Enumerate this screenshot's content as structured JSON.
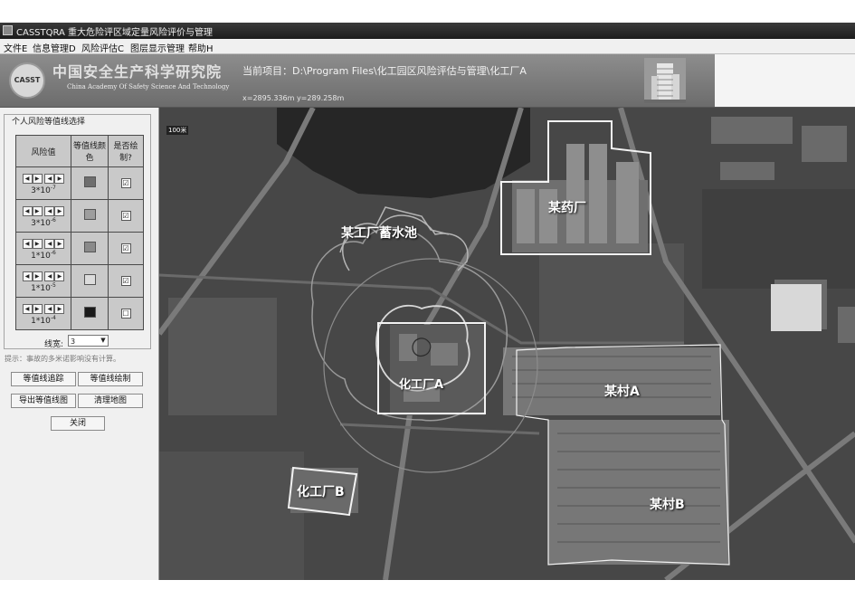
{
  "window": {
    "title": "CASSTQRA 重大危险评区域定量风险评价与管理"
  },
  "menu": [
    "文件E",
    "信息管理D",
    "风险评估C",
    "图层显示管理",
    "帮助H"
  ],
  "header": {
    "logo_text": "CASST",
    "org_cn": "中国安全生产科学研究院",
    "org_en": "China Academy Of Safety Science And Technology",
    "project_label": "当前项目：",
    "project_path": "D:\\Program Files\\化工园区风险评估与管理\\化工厂A",
    "coords": "x=2895.336m   y=289.258m"
  },
  "panel": {
    "group_title": "个人风险等值线选择",
    "col_risk": "风险值",
    "col_color": "等值线颜色",
    "col_draw": "是否绘制?",
    "rows": [
      {
        "base": "3*10",
        "exp": "-7",
        "color": "#6e6e6e",
        "checked": "☑"
      },
      {
        "base": "3*10",
        "exp": "-6",
        "color": "#9e9e9e",
        "checked": "☑"
      },
      {
        "base": "1*10",
        "exp": "-6",
        "color": "#8a8a8a",
        "checked": "☑"
      },
      {
        "base": "1*10",
        "exp": "-5",
        "color": "#dcdcdc",
        "checked": "☑"
      },
      {
        "base": "1*10",
        "exp": "-4",
        "color": "#1a1a1a",
        "checked": "☐"
      }
    ],
    "arrow_left": "◀",
    "arrow_right": "▶",
    "line_width_label": "线宽:",
    "line_width_value": "3",
    "hint": "提示：事故的多米诺影响没有计算。",
    "buttons": {
      "trace": "等值线追踪",
      "draw": "等值线绘制",
      "export": "导出等值线图",
      "clear": "清理地图",
      "close": "关闭"
    }
  },
  "map": {
    "scale": "100米",
    "labels": {
      "pond": "某工厂蓄水池",
      "pharma": "某药厂",
      "plant_a": "化工厂A",
      "plant_b": "化工厂B",
      "village_a": "某村A",
      "village_b": "某村B"
    }
  }
}
